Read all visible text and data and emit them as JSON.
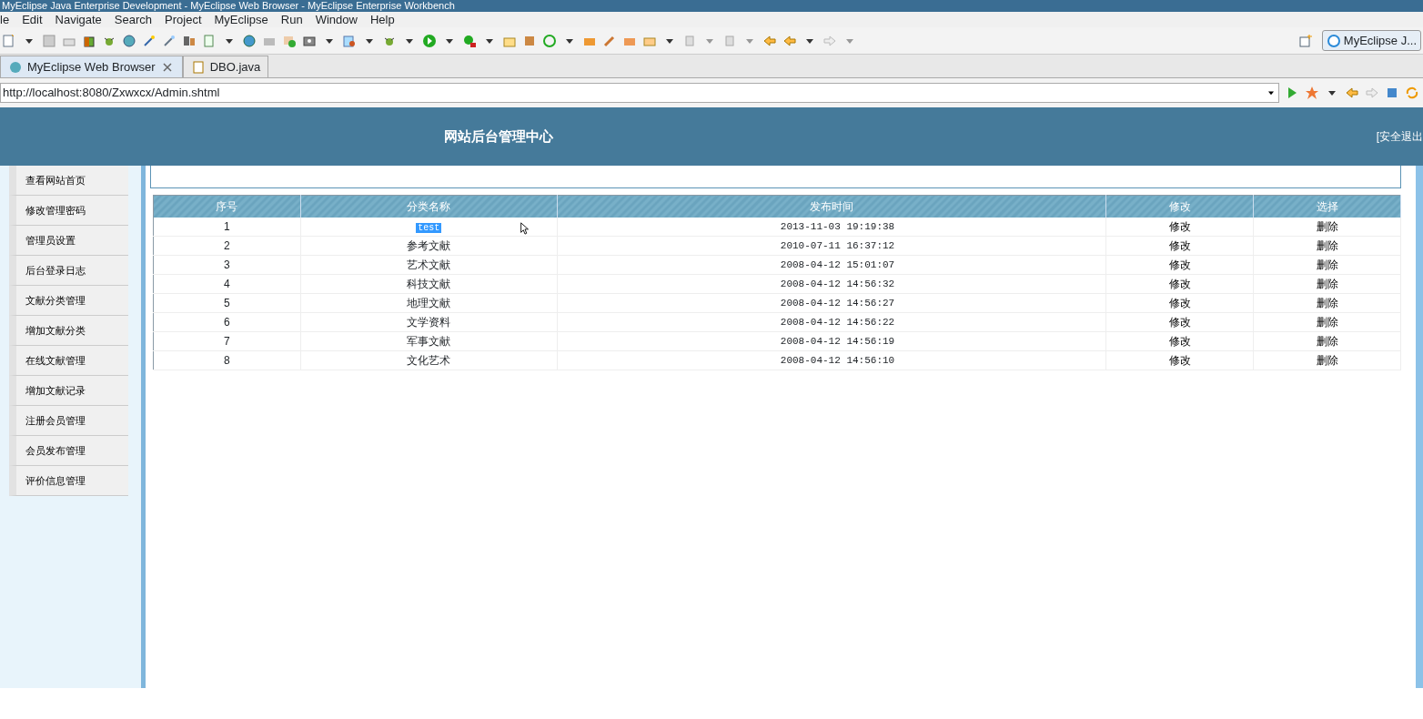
{
  "window": {
    "title": "MyEclipse Java Enterprise Development - MyEclipse Web Browser - MyEclipse Enterprise Workbench"
  },
  "menu": [
    "le",
    "Edit",
    "Navigate",
    "Search",
    "Project",
    "MyEclipse",
    "Run",
    "Window",
    "Help"
  ],
  "perspective": {
    "label": "MyEclipse J..."
  },
  "tabs": [
    {
      "label": "MyEclipse Web Browser",
      "selected": true,
      "closable": true
    },
    {
      "label": "DBO.java",
      "selected": false,
      "closable": false
    }
  ],
  "address": {
    "value": "http://localhost:8080/Zxwxcx/Admin.shtml"
  },
  "page": {
    "header_title": "网站后台管理中心",
    "logout": "[安全退出",
    "sidebar": [
      "查看网站首页",
      "修改管理密码",
      "管理员设置",
      "后台登录日志",
      "文献分类管理",
      "增加文献分类",
      "在线文献管理",
      "增加文献记录",
      "注册会员管理",
      "会员发布管理",
      "评价信息管理"
    ],
    "table": {
      "columns": [
        "序号",
        "分类名称",
        "发布时间",
        "修改",
        "选择"
      ],
      "rows": [
        {
          "no": "1",
          "name": "test",
          "highlighted": true,
          "time": "2013-11-03 19:19:38",
          "edit": "修改",
          "delete": "删除"
        },
        {
          "no": "2",
          "name": "参考文献",
          "highlighted": false,
          "time": "2010-07-11 16:37:12",
          "edit": "修改",
          "delete": "删除"
        },
        {
          "no": "3",
          "name": "艺术文献",
          "highlighted": false,
          "time": "2008-04-12 15:01:07",
          "edit": "修改",
          "delete": "删除"
        },
        {
          "no": "4",
          "name": "科技文献",
          "highlighted": false,
          "time": "2008-04-12 14:56:32",
          "edit": "修改",
          "delete": "删除"
        },
        {
          "no": "5",
          "name": "地理文献",
          "highlighted": false,
          "time": "2008-04-12 14:56:27",
          "edit": "修改",
          "delete": "删除"
        },
        {
          "no": "6",
          "name": "文学资料",
          "highlighted": false,
          "time": "2008-04-12 14:56:22",
          "edit": "修改",
          "delete": "删除"
        },
        {
          "no": "7",
          "name": "军事文献",
          "highlighted": false,
          "time": "2008-04-12 14:56:19",
          "edit": "修改",
          "delete": "删除"
        },
        {
          "no": "8",
          "name": "文化艺术",
          "highlighted": false,
          "time": "2008-04-12 14:56:10",
          "edit": "修改",
          "delete": "删除"
        }
      ]
    }
  }
}
